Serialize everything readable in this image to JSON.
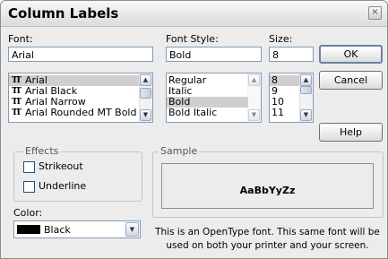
{
  "dialog": {
    "title": "Column Labels",
    "close_glyph": "×"
  },
  "font": {
    "label": "Font:",
    "value": "Arial",
    "icon_glyph": "TT",
    "items": [
      {
        "label": "Arial",
        "selected": true
      },
      {
        "label": "Arial Black",
        "selected": false
      },
      {
        "label": "Arial Narrow",
        "selected": false
      },
      {
        "label": "Arial Rounded MT Bold",
        "selected": false
      }
    ]
  },
  "font_style": {
    "label": "Font Style:",
    "value": "Bold",
    "items": [
      {
        "label": "Regular",
        "selected": false
      },
      {
        "label": "Italic",
        "selected": false
      },
      {
        "label": "Bold",
        "selected": true
      },
      {
        "label": "Bold Italic",
        "selected": false
      }
    ]
  },
  "size": {
    "label": "Size:",
    "value": "8",
    "items": [
      {
        "label": "8",
        "selected": true
      },
      {
        "label": "9",
        "selected": false
      },
      {
        "label": "10",
        "selected": false
      },
      {
        "label": "11",
        "selected": false
      }
    ]
  },
  "buttons": {
    "ok": "OK",
    "cancel": "Cancel",
    "help": "Help"
  },
  "effects": {
    "label": "Effects",
    "strikeout": {
      "label": "Strikeout",
      "checked": false
    },
    "underline": {
      "label": "Underline",
      "checked": false
    }
  },
  "color": {
    "label": "Color:",
    "value": "Black",
    "swatch": "#000000"
  },
  "sample": {
    "label": "Sample",
    "text": "AaBbYyZz"
  },
  "description": {
    "line1": "This is an OpenType font. This same font will be",
    "line2": "used on both your printer and your screen."
  },
  "icons": {
    "scroll_up": "▲",
    "scroll_down": "▼"
  }
}
